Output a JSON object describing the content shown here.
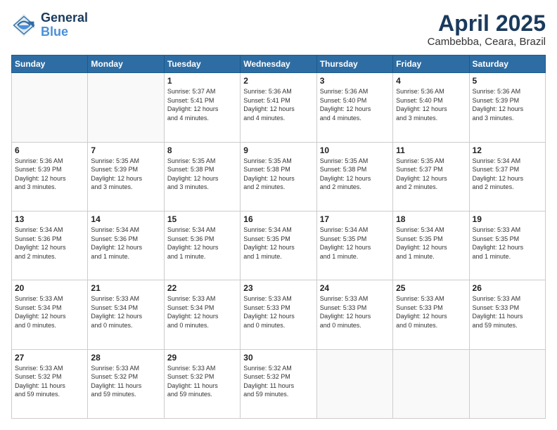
{
  "header": {
    "logo_line1": "General",
    "logo_line2": "Blue",
    "main_title": "April 2025",
    "subtitle": "Cambebba, Ceara, Brazil"
  },
  "calendar": {
    "days_of_week": [
      "Sunday",
      "Monday",
      "Tuesday",
      "Wednesday",
      "Thursday",
      "Friday",
      "Saturday"
    ],
    "weeks": [
      [
        {
          "day": "",
          "info": ""
        },
        {
          "day": "",
          "info": ""
        },
        {
          "day": "1",
          "info": "Sunrise: 5:37 AM\nSunset: 5:41 PM\nDaylight: 12 hours\nand 4 minutes."
        },
        {
          "day": "2",
          "info": "Sunrise: 5:36 AM\nSunset: 5:41 PM\nDaylight: 12 hours\nand 4 minutes."
        },
        {
          "day": "3",
          "info": "Sunrise: 5:36 AM\nSunset: 5:40 PM\nDaylight: 12 hours\nand 4 minutes."
        },
        {
          "day": "4",
          "info": "Sunrise: 5:36 AM\nSunset: 5:40 PM\nDaylight: 12 hours\nand 3 minutes."
        },
        {
          "day": "5",
          "info": "Sunrise: 5:36 AM\nSunset: 5:39 PM\nDaylight: 12 hours\nand 3 minutes."
        }
      ],
      [
        {
          "day": "6",
          "info": "Sunrise: 5:36 AM\nSunset: 5:39 PM\nDaylight: 12 hours\nand 3 minutes."
        },
        {
          "day": "7",
          "info": "Sunrise: 5:35 AM\nSunset: 5:39 PM\nDaylight: 12 hours\nand 3 minutes."
        },
        {
          "day": "8",
          "info": "Sunrise: 5:35 AM\nSunset: 5:38 PM\nDaylight: 12 hours\nand 3 minutes."
        },
        {
          "day": "9",
          "info": "Sunrise: 5:35 AM\nSunset: 5:38 PM\nDaylight: 12 hours\nand 2 minutes."
        },
        {
          "day": "10",
          "info": "Sunrise: 5:35 AM\nSunset: 5:38 PM\nDaylight: 12 hours\nand 2 minutes."
        },
        {
          "day": "11",
          "info": "Sunrise: 5:35 AM\nSunset: 5:37 PM\nDaylight: 12 hours\nand 2 minutes."
        },
        {
          "day": "12",
          "info": "Sunrise: 5:34 AM\nSunset: 5:37 PM\nDaylight: 12 hours\nand 2 minutes."
        }
      ],
      [
        {
          "day": "13",
          "info": "Sunrise: 5:34 AM\nSunset: 5:36 PM\nDaylight: 12 hours\nand 2 minutes."
        },
        {
          "day": "14",
          "info": "Sunrise: 5:34 AM\nSunset: 5:36 PM\nDaylight: 12 hours\nand 1 minute."
        },
        {
          "day": "15",
          "info": "Sunrise: 5:34 AM\nSunset: 5:36 PM\nDaylight: 12 hours\nand 1 minute."
        },
        {
          "day": "16",
          "info": "Sunrise: 5:34 AM\nSunset: 5:35 PM\nDaylight: 12 hours\nand 1 minute."
        },
        {
          "day": "17",
          "info": "Sunrise: 5:34 AM\nSunset: 5:35 PM\nDaylight: 12 hours\nand 1 minute."
        },
        {
          "day": "18",
          "info": "Sunrise: 5:34 AM\nSunset: 5:35 PM\nDaylight: 12 hours\nand 1 minute."
        },
        {
          "day": "19",
          "info": "Sunrise: 5:33 AM\nSunset: 5:35 PM\nDaylight: 12 hours\nand 1 minute."
        }
      ],
      [
        {
          "day": "20",
          "info": "Sunrise: 5:33 AM\nSunset: 5:34 PM\nDaylight: 12 hours\nand 0 minutes."
        },
        {
          "day": "21",
          "info": "Sunrise: 5:33 AM\nSunset: 5:34 PM\nDaylight: 12 hours\nand 0 minutes."
        },
        {
          "day": "22",
          "info": "Sunrise: 5:33 AM\nSunset: 5:34 PM\nDaylight: 12 hours\nand 0 minutes."
        },
        {
          "day": "23",
          "info": "Sunrise: 5:33 AM\nSunset: 5:33 PM\nDaylight: 12 hours\nand 0 minutes."
        },
        {
          "day": "24",
          "info": "Sunrise: 5:33 AM\nSunset: 5:33 PM\nDaylight: 12 hours\nand 0 minutes."
        },
        {
          "day": "25",
          "info": "Sunrise: 5:33 AM\nSunset: 5:33 PM\nDaylight: 12 hours\nand 0 minutes."
        },
        {
          "day": "26",
          "info": "Sunrise: 5:33 AM\nSunset: 5:33 PM\nDaylight: 11 hours\nand 59 minutes."
        }
      ],
      [
        {
          "day": "27",
          "info": "Sunrise: 5:33 AM\nSunset: 5:32 PM\nDaylight: 11 hours\nand 59 minutes."
        },
        {
          "day": "28",
          "info": "Sunrise: 5:33 AM\nSunset: 5:32 PM\nDaylight: 11 hours\nand 59 minutes."
        },
        {
          "day": "29",
          "info": "Sunrise: 5:33 AM\nSunset: 5:32 PM\nDaylight: 11 hours\nand 59 minutes."
        },
        {
          "day": "30",
          "info": "Sunrise: 5:32 AM\nSunset: 5:32 PM\nDaylight: 11 hours\nand 59 minutes."
        },
        {
          "day": "",
          "info": ""
        },
        {
          "day": "",
          "info": ""
        },
        {
          "day": "",
          "info": ""
        }
      ]
    ]
  }
}
